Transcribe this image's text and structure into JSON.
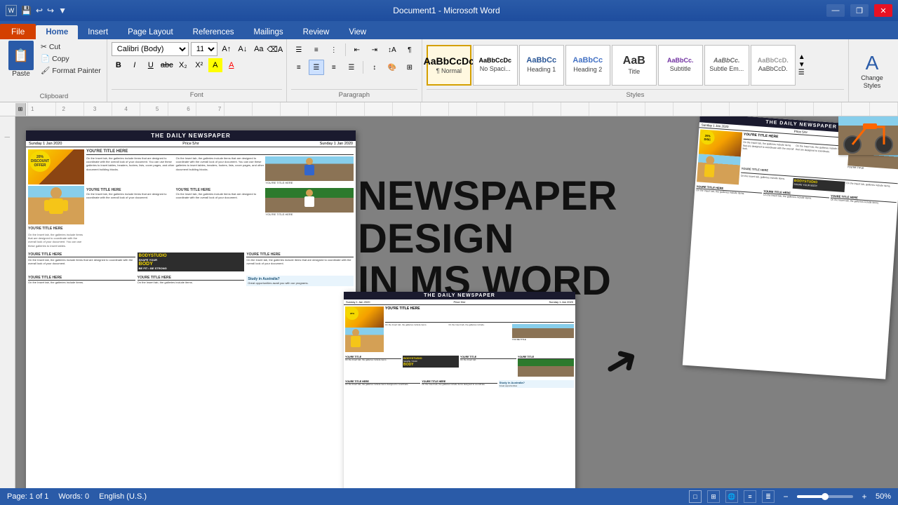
{
  "titlebar": {
    "title": "Document1 - Microsoft Word",
    "minimize": "—",
    "restore": "❐",
    "close": "✕",
    "quickaccess": [
      "💾",
      "↩",
      "↪"
    ]
  },
  "tabs": {
    "file": "File",
    "home": "Home",
    "insert": "Insert",
    "pageLayout": "Page Layout",
    "references": "References",
    "mailings": "Mailings",
    "review": "Review",
    "view": "View"
  },
  "ribbon": {
    "clipboard": {
      "label": "Clipboard",
      "paste": "Paste",
      "cut": "Cut",
      "copy": "Copy",
      "formatPainter": "Format Painter"
    },
    "font": {
      "label": "Font",
      "fontName": "Calibri (Body)",
      "fontSize": "11",
      "bold": "B",
      "italic": "I",
      "underline": "U",
      "strikethrough": "abc",
      "subscript": "X₂",
      "superscript": "X²",
      "textHighlight": "A",
      "fontColor": "A"
    },
    "paragraph": {
      "label": "Paragraph"
    },
    "styles": {
      "label": "Styles",
      "items": [
        {
          "key": "normal",
          "text": "AaBbCcDc",
          "label": "¶ Normal",
          "active": true
        },
        {
          "key": "no-spacing",
          "text": "AaBbCcDc",
          "label": "No Spaci..."
        },
        {
          "key": "heading1",
          "text": "AaBbCc",
          "label": "Heading 1"
        },
        {
          "key": "heading2",
          "text": "AaBbCc",
          "label": "Heading 2"
        },
        {
          "key": "title",
          "text": "AaB",
          "label": "Title"
        },
        {
          "key": "subtitle",
          "text": "AaBbCc.",
          "label": "Subtitle"
        },
        {
          "key": "subtle-em",
          "text": "AaBbCc.",
          "label": "Subtle Em..."
        },
        {
          "key": "more",
          "text": "AaBbCcD.",
          "label": "AaBbCcD."
        }
      ]
    },
    "changeStyles": {
      "label": "Change\nStyles"
    }
  },
  "doc": {
    "newspaper": {
      "name": "THE DAILY NEWSPAPER",
      "date1": "Sunday 1 Jan 2020",
      "price": "Price 5/nr",
      "date2": "Sunday 1 Jan 2020",
      "youre_title": "YOU'RE TITLE HERE",
      "sample_text": "On the Insert tab, the galleries include items that are designed to coordinate with the overall look of your document. You can use these galleries to insert tables, headers, footers, lists, cover pages, and other document building blocks.",
      "columns": [
        {
          "title": "YOU'RE TITLE HERE",
          "body": "On the Insert tab, the galleries include items that are designed to coordinate with the overall look of your document. You can use these galleries to insert tables, headers, footers, lists, cover pages, and other document building blocks."
        },
        {
          "title": "YOU'RE TITLE HERE",
          "body": "On the Insert tab, the galleries include items that are designed to coordinate with the overall look of your document. You can use these galleries to insert tables, headers, footers, lists, cover pages, and other document building blocks."
        }
      ]
    }
  },
  "promo": {
    "line1": "NEWSPAPER DESIGN",
    "line2": "IN MS WORD"
  },
  "statusbar": {
    "page": "Page: 1 of 1",
    "words": "Words: 0",
    "language": "English (U.S.)",
    "zoom": "50%"
  }
}
